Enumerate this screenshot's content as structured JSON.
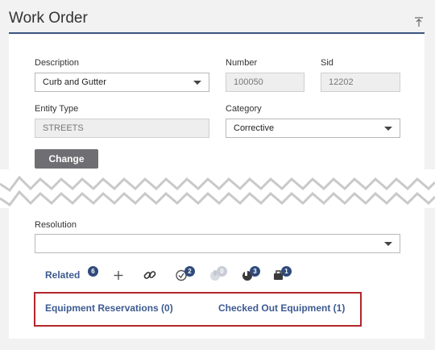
{
  "header": {
    "title": "Work Order",
    "collapse_icon": "collapse-up-icon"
  },
  "form": {
    "description": {
      "label": "Description",
      "value": "Curb and Gutter"
    },
    "number": {
      "label": "Number",
      "value": "100050"
    },
    "sid": {
      "label": "Sid",
      "value": "12202"
    },
    "entity_type": {
      "label": "Entity Type",
      "value": "STREETS"
    },
    "category": {
      "label": "Category",
      "value": "Corrective"
    },
    "change_button": "Change",
    "resolution": {
      "label": "Resolution",
      "value": ""
    }
  },
  "toolbar": {
    "related_label": "Related",
    "related_count": "6",
    "badges": {
      "comments": "2",
      "attachments": "0",
      "tasks": "3",
      "equipment": "1"
    }
  },
  "tabs": [
    {
      "label": "Equipment Reservations (0)"
    },
    {
      "label": "Checked Out Equipment (1)"
    }
  ],
  "colors": {
    "accent": "#3d5a91",
    "highlight": "#b3252c",
    "rule": "#3e5680"
  }
}
